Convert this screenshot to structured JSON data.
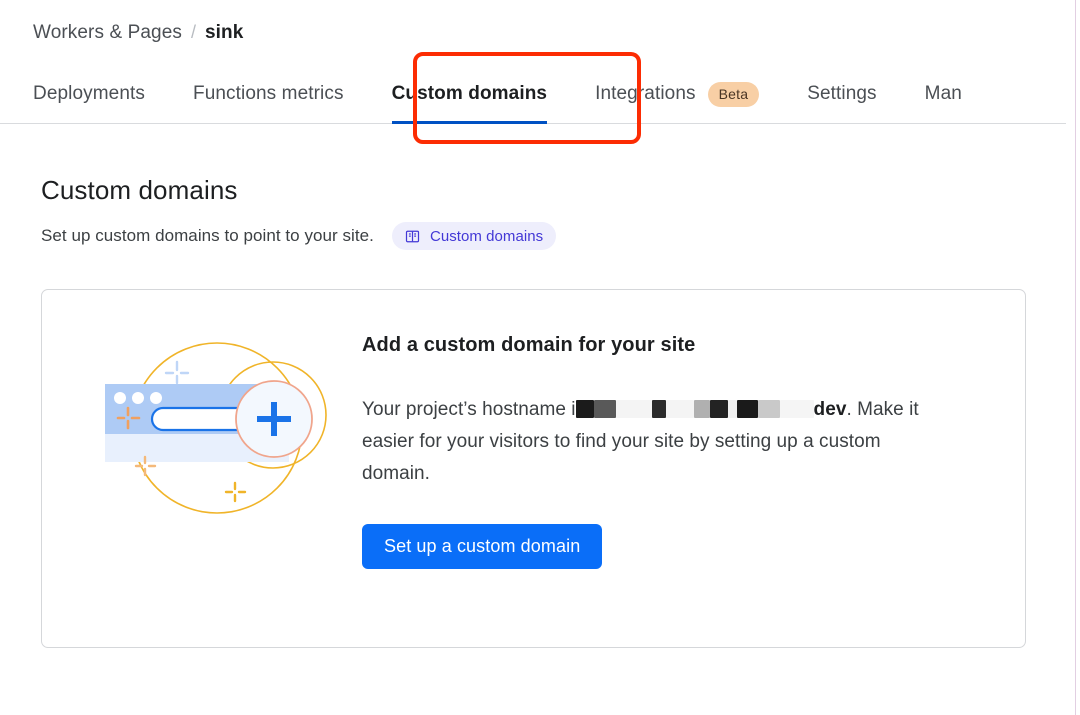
{
  "breadcrumb": {
    "parent": "Workers & Pages",
    "separator": "/",
    "current": "sink"
  },
  "tabs": [
    {
      "label": "Deployments",
      "active": false,
      "badge": null
    },
    {
      "label": "Functions metrics",
      "active": false,
      "badge": null
    },
    {
      "label": "Custom domains",
      "active": true,
      "badge": null
    },
    {
      "label": "Integrations",
      "active": false,
      "badge": "Beta"
    },
    {
      "label": "Settings",
      "active": false,
      "badge": null
    },
    {
      "label": "Man",
      "active": false,
      "badge": null
    }
  ],
  "annotation": {
    "color": "#fc2c03",
    "target_tab": "Custom domains"
  },
  "main": {
    "title": "Custom domains",
    "subtitle": "Set up custom domains to point to your site.",
    "doc_pill": {
      "icon": "book-icon",
      "label": "Custom domains",
      "color": "#4338d6",
      "background": "#eeeefc"
    }
  },
  "card": {
    "heading": "Add a custom domain for your site",
    "body_prefix": "Your project’s hostname i",
    "body_redacted_note": "hostname redacted",
    "body_bold": "dev",
    "body_suffix": ". Make it easier for your visitors to find your site by setting up a custom domain.",
    "cta_label": "Set up a custom domain",
    "cta_color": "#0a6ef8",
    "illustration": {
      "name": "add-custom-domain-illustration",
      "browser_header_color": "#aecbf5",
      "browser_body_color": "#e8f0fd",
      "search_bar_outline": "#1a73e8",
      "plus_color": "#1a73e8",
      "ring_color": "#f0b429",
      "plus_ring_color": "#f0a58c"
    }
  }
}
